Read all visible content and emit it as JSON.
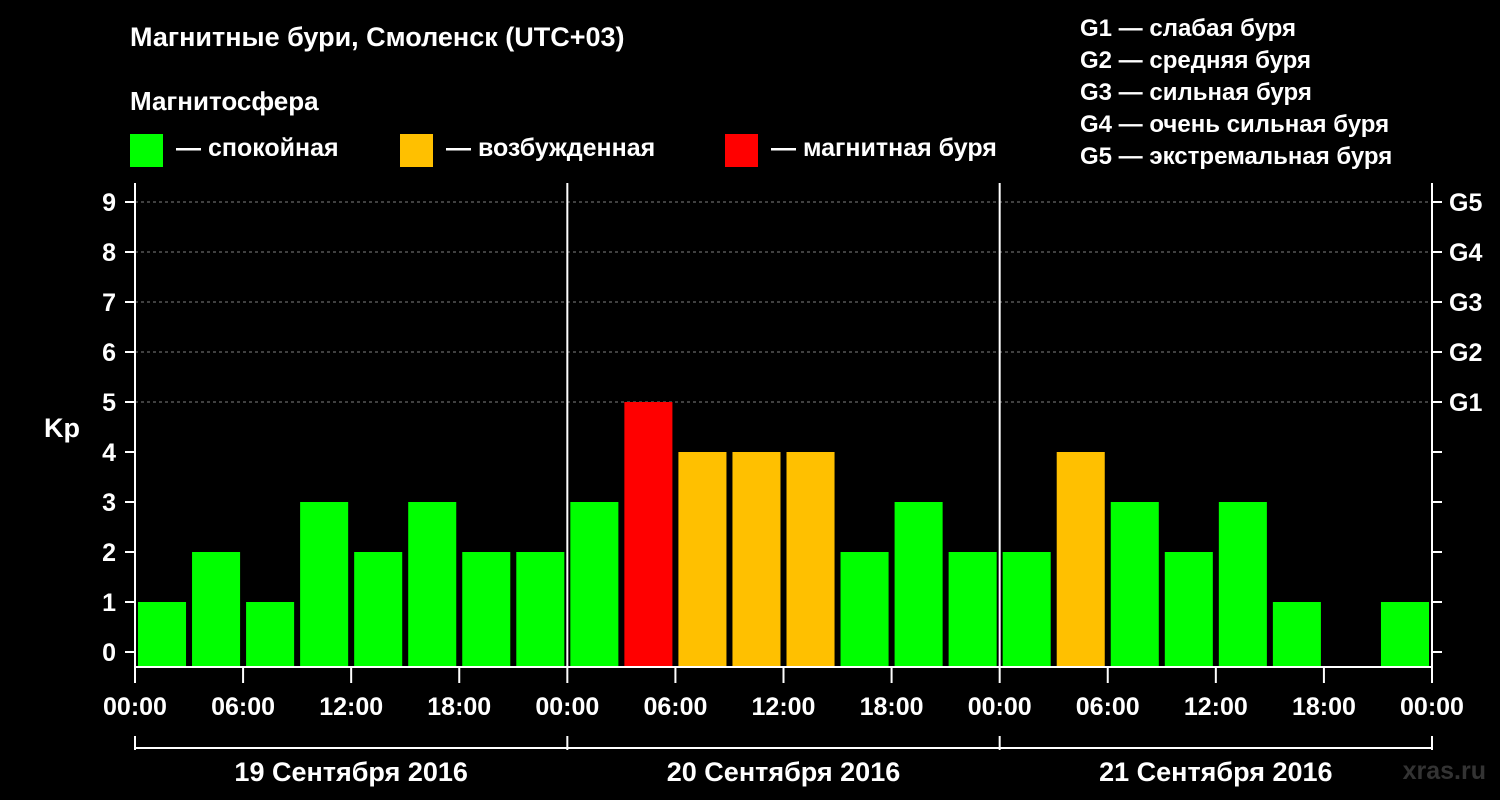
{
  "title": "Магнитные бури, Смоленск (UTC+03)",
  "subtitle": "Магнитосфера",
  "legend": [
    {
      "label": "— спокойная",
      "color": "#00ff00"
    },
    {
      "label": "— возбужденная",
      "color": "#ffc000"
    },
    {
      "label": "— магнитная буря",
      "color": "#ff0000"
    }
  ],
  "g_scale": [
    "G1 — слабая буря",
    "G2 — средняя буря",
    "G3 — сильная буря",
    "G4 — очень сильная буря",
    "G5 — экстремальная буря"
  ],
  "watermark": "xras.ru",
  "chart_data": {
    "type": "bar",
    "ylabel": "Kp",
    "ylim": [
      0,
      9
    ],
    "yticks": [
      "0",
      "1",
      "2",
      "3",
      "4",
      "5",
      "6",
      "7",
      "8",
      "9"
    ],
    "right_labels": [
      {
        "value": 5,
        "label": "G1"
      },
      {
        "value": 6,
        "label": "G2"
      },
      {
        "value": 7,
        "label": "G3"
      },
      {
        "value": 8,
        "label": "G4"
      },
      {
        "value": 9,
        "label": "G5"
      }
    ],
    "grid": "dashed at Kp 5–9",
    "xtick_labels": [
      "00:00",
      "06:00",
      "12:00",
      "18:00",
      "00:00",
      "06:00",
      "12:00",
      "18:00",
      "00:00",
      "06:00",
      "12:00",
      "18:00",
      "00:00"
    ],
    "interval_hours": 3,
    "days": [
      {
        "label": "19 Сентября 2016",
        "values": [
          1,
          2,
          1,
          3,
          2,
          3,
          2,
          2
        ]
      },
      {
        "label": "20 Сентября 2016",
        "values": [
          3,
          5,
          4,
          4,
          4,
          2,
          3,
          2
        ]
      },
      {
        "label": "21 Сентября 2016",
        "values": [
          2,
          4,
          3,
          2,
          3,
          1,
          0,
          1
        ]
      }
    ],
    "color_rule": {
      "quiet_max": 3,
      "active_max": 4,
      "quiet": "#00ff00",
      "active": "#ffc000",
      "storm": "#ff0000"
    }
  }
}
